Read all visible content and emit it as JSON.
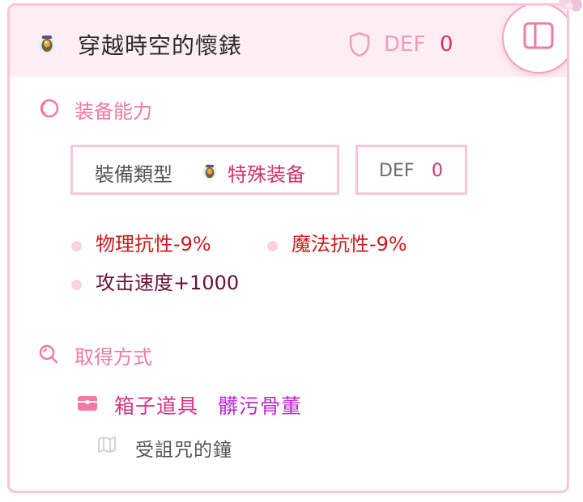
{
  "header": {
    "item_name": "穿越時空的懷錶",
    "def_label": "DEF",
    "def_value": "0",
    "icons": [
      "jar-icon",
      "shield-icon",
      "sidebar-toggle-icon"
    ]
  },
  "abilities": {
    "title": "装备能力",
    "type_label": "裝備類型",
    "type_value": "特殊装备",
    "def_label": "DEF",
    "def_value": "0",
    "stats": [
      {
        "text": "物理抗性-9%"
      },
      {
        "text": "魔法抗性-9%"
      },
      {
        "text": "攻击速度+1000"
      }
    ]
  },
  "acquire": {
    "title": "取得方式",
    "source_type": "箱子道具",
    "source_name": "髒污骨董",
    "map_name": "受詛咒的鐘"
  },
  "colors": {
    "accent": "#f27aa0",
    "border": "#f8c6d6",
    "header_bg": "#fdeef3",
    "stat_negative": "#cc1b1b",
    "stat_positive": "#6b0f3a",
    "source_name": "#c026d3"
  }
}
